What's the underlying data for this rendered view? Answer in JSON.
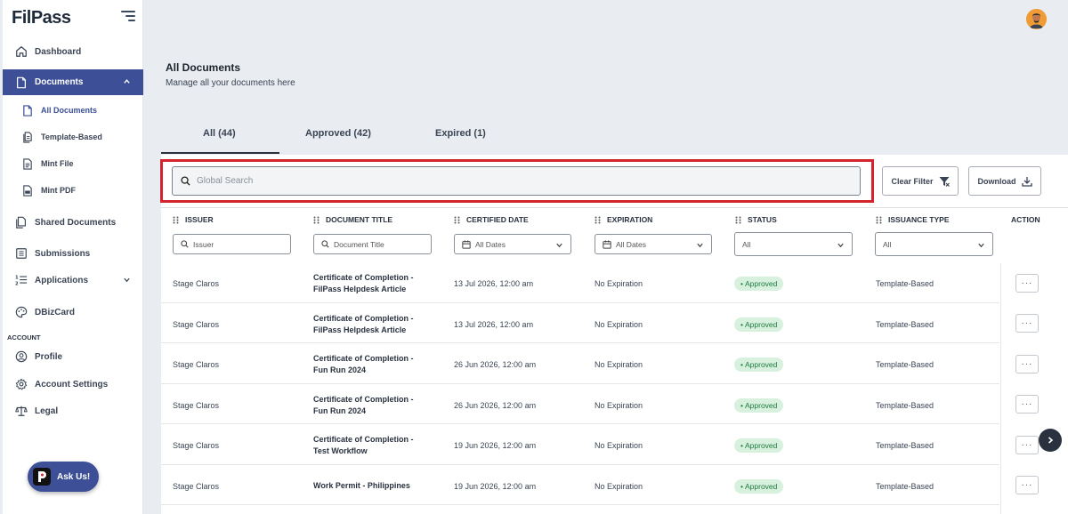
{
  "app": {
    "logo_text_1": "Fil",
    "logo_text_2": "Pass",
    "brand_color": "#3c4f97",
    "accent_red": "#d3232d"
  },
  "sidebar": {
    "items": [
      {
        "label": "Dashboard",
        "icon": "home-icon"
      },
      {
        "label": "Documents",
        "icon": "document-icon",
        "active": true,
        "expanded": true
      },
      {
        "label": "Shared Documents",
        "icon": "shared-documents-icon"
      },
      {
        "label": "Submissions",
        "icon": "submissions-icon"
      },
      {
        "label": "Applications",
        "icon": "applications-icon"
      },
      {
        "label": "DBizCard",
        "icon": "palette-icon"
      }
    ],
    "sub_items": [
      {
        "label": "All Documents",
        "current": true
      },
      {
        "label": "Template-Based"
      },
      {
        "label": "Mint File"
      },
      {
        "label": "Mint PDF"
      }
    ],
    "account_label": "ACCOUNT",
    "account_items": [
      {
        "label": "Profile",
        "icon": "profile-icon"
      },
      {
        "label": "Account Settings",
        "icon": "gear-icon"
      },
      {
        "label": "Legal",
        "icon": "scales-icon"
      }
    ],
    "ask_us": "Ask Us!"
  },
  "header": {
    "title": "All Documents",
    "subtitle": "Manage all your documents here"
  },
  "tabs": [
    {
      "label": "All (44)",
      "active": true
    },
    {
      "label": "Approved (42)"
    },
    {
      "label": "Expired (1)"
    }
  ],
  "toolbar": {
    "search_placeholder": "Global Search",
    "clear_filter": "Clear Filter",
    "download": "Download"
  },
  "table": {
    "columns": [
      "ISSUER",
      "DOCUMENT TITLE",
      "CERTIFIED DATE",
      "EXPIRATION",
      "STATUS",
      "ISSUANCE TYPE",
      "ACTION"
    ],
    "filters": {
      "issuer_placeholder": "Issuer",
      "title_placeholder": "Document Title",
      "certified_date": "All Dates",
      "expiration": "All Dates",
      "status": "All",
      "issuance_type": "All"
    },
    "rows": [
      {
        "issuer": "Stage Claros",
        "title_1": "Certificate of Completion -",
        "title_2": "FilPass Helpdesk Article",
        "certified": "13 Jul 2026, 12:00 am",
        "expiration": "No Expiration",
        "status": "Approved",
        "type": "Template-Based"
      },
      {
        "issuer": "Stage Claros",
        "title_1": "Certificate of Completion -",
        "title_2": "FilPass Helpdesk Article",
        "certified": "13 Jul 2026, 12:00 am",
        "expiration": "No Expiration",
        "status": "Approved",
        "type": "Template-Based"
      },
      {
        "issuer": "Stage Claros",
        "title_1": "Certificate of Completion -",
        "title_2": "Fun Run 2024",
        "certified": "26 Jun 2026, 12:00 am",
        "expiration": "No Expiration",
        "status": "Approved",
        "type": "Template-Based"
      },
      {
        "issuer": "Stage Claros",
        "title_1": "Certificate of Completion -",
        "title_2": "Fun Run 2024",
        "certified": "26 Jun 2026, 12:00 am",
        "expiration": "No Expiration",
        "status": "Approved",
        "type": "Template-Based"
      },
      {
        "issuer": "Stage Claros",
        "title_1": "Certificate of Completion -",
        "title_2": "Test Workflow",
        "certified": "19 Jun 2026, 12:00 am",
        "expiration": "No Expiration",
        "status": "Approved",
        "type": "Template-Based"
      },
      {
        "issuer": "Stage Claros",
        "title_1": "Work Permit - Philippines",
        "title_2": "",
        "certified": "19 Jun 2026, 12:00 am",
        "expiration": "No Expiration",
        "status": "Approved",
        "type": "Template-Based"
      }
    ],
    "action_label": "···"
  }
}
